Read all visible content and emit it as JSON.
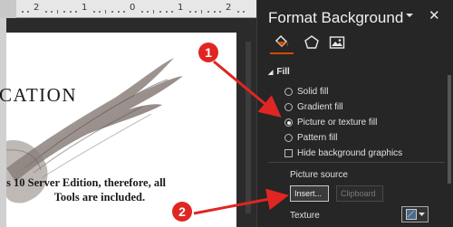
{
  "ruler": {
    "numbers": [
      "2",
      "1",
      "0",
      "1",
      "2"
    ]
  },
  "slide": {
    "title": "CATION",
    "body_line1": "s 10 Server Edition, therefore, all",
    "body_line2": "Tools are included."
  },
  "pane": {
    "title": "Format Background",
    "close_glyph": "✕",
    "tabs": [
      {
        "icon": "fill-bucket-icon",
        "active": true
      },
      {
        "icon": "pentagon-icon",
        "active": false
      },
      {
        "icon": "picture-icon",
        "active": false
      }
    ],
    "fill_section": {
      "header": "Fill",
      "options": [
        {
          "label": "Solid fill",
          "selected": false
        },
        {
          "label": "Gradient fill",
          "selected": false
        },
        {
          "label": "Picture or texture fill",
          "selected": true
        },
        {
          "label": "Pattern fill",
          "selected": false
        }
      ],
      "hide_bg_label": "Hide background graphics",
      "hide_bg_checked": false,
      "picture_source_label": "Picture source",
      "insert_label": "Insert...",
      "clipboard_label": "Clipboard",
      "texture_label": "Texture"
    }
  },
  "annotations": {
    "step1": "1",
    "step2": "2",
    "color": "#e02622"
  },
  "colors": {
    "accent": "#d04a02",
    "pane_bg": "#262626",
    "slide_bg": "#ffffff"
  }
}
